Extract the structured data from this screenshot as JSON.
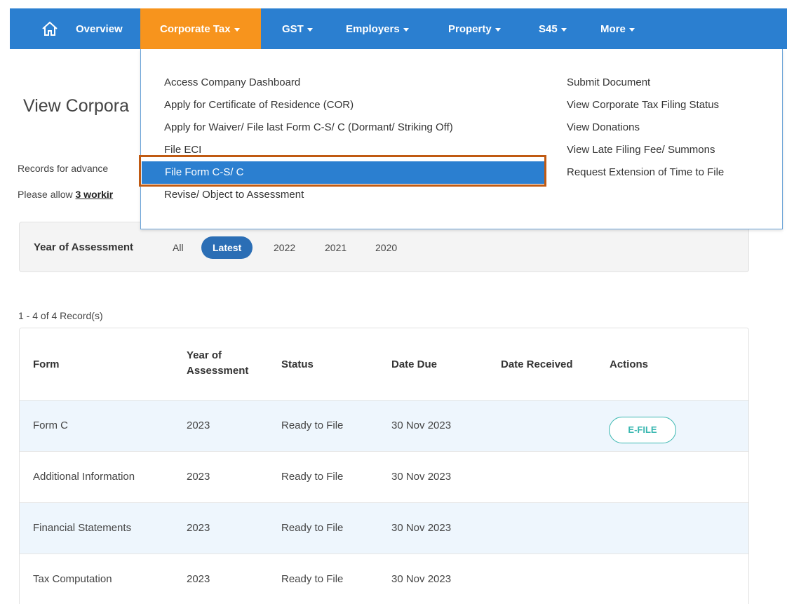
{
  "nav": {
    "home_icon": "home-icon",
    "items": [
      {
        "label": "Overview",
        "has_caret": false
      },
      {
        "label": "Corporate Tax",
        "has_caret": true,
        "active": true
      },
      {
        "label": "GST",
        "has_caret": true
      },
      {
        "label": "Employers",
        "has_caret": true
      },
      {
        "label": "Property",
        "has_caret": true
      },
      {
        "label": "S45",
        "has_caret": true
      },
      {
        "label": "More",
        "has_caret": true
      }
    ],
    "colors": {
      "bar": "#2b7fd0",
      "active": "#f7941d"
    }
  },
  "dropdown": {
    "left_column": [
      "Access Company Dashboard",
      "Apply for Certificate of Residence (COR)",
      "Apply for Waiver/ File last Form C-S/ C (Dormant/ Striking Off)",
      "File ECI",
      "File Form C-S/ C",
      "Revise/ Object to Assessment"
    ],
    "right_column": [
      "Submit Document",
      "View Corporate Tax Filing Status",
      "View Donations",
      "View Late Filing Fee/ Summons",
      "Request Extension of Time to File"
    ],
    "highlighted_item": "File Form C-S/ C",
    "highlight_outline_color": "#c05a12"
  },
  "page": {
    "title": "View Corpora",
    "info_1": "Records for advance",
    "info_2_prefix": "Please allow ",
    "info_2_bold": "3 workir"
  },
  "filter": {
    "label": "Year of Assessment",
    "options": [
      "All",
      "Latest",
      "2022",
      "2021",
      "2020"
    ],
    "selected": "Latest"
  },
  "records": {
    "count_text": "1 - 4 of 4 Record(s)"
  },
  "table": {
    "headers": {
      "form": "Form",
      "year_line1": "Year of",
      "year_line2": "Assessment",
      "status": "Status",
      "date_due": "Date Due",
      "date_received": "Date Received",
      "actions": "Actions"
    },
    "rows": [
      {
        "form": "Form C",
        "year": "2023",
        "status": "Ready to File",
        "date_due": "30 Nov 2023",
        "date_received": "",
        "action": "E-FILE"
      },
      {
        "form": "Additional Information",
        "year": "2023",
        "status": "Ready to File",
        "date_due": "30 Nov 2023",
        "date_received": "",
        "action": ""
      },
      {
        "form": "Financial Statements",
        "year": "2023",
        "status": "Ready to File",
        "date_due": "30 Nov 2023",
        "date_received": "",
        "action": ""
      },
      {
        "form": "Tax Computation",
        "year": "2023",
        "status": "Ready to File",
        "date_due": "30 Nov 2023",
        "date_received": "",
        "action": ""
      }
    ]
  }
}
